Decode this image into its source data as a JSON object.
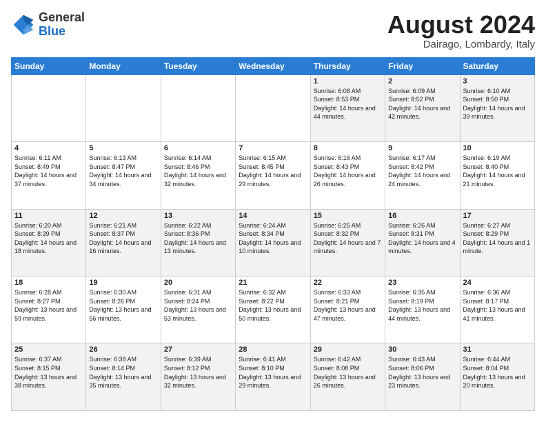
{
  "header": {
    "logo_line1": "General",
    "logo_line2": "Blue",
    "month_year": "August 2024",
    "location": "Dairago, Lombardy, Italy"
  },
  "days_of_week": [
    "Sunday",
    "Monday",
    "Tuesday",
    "Wednesday",
    "Thursday",
    "Friday",
    "Saturday"
  ],
  "weeks": [
    [
      {
        "day": "",
        "info": ""
      },
      {
        "day": "",
        "info": ""
      },
      {
        "day": "",
        "info": ""
      },
      {
        "day": "",
        "info": ""
      },
      {
        "day": "1",
        "info": "Sunrise: 6:08 AM\nSunset: 8:53 PM\nDaylight: 14 hours and 44 minutes."
      },
      {
        "day": "2",
        "info": "Sunrise: 6:09 AM\nSunset: 8:52 PM\nDaylight: 14 hours and 42 minutes."
      },
      {
        "day": "3",
        "info": "Sunrise: 6:10 AM\nSunset: 8:50 PM\nDaylight: 14 hours and 39 minutes."
      }
    ],
    [
      {
        "day": "4",
        "info": "Sunrise: 6:11 AM\nSunset: 8:49 PM\nDaylight: 14 hours and 37 minutes."
      },
      {
        "day": "5",
        "info": "Sunrise: 6:13 AM\nSunset: 8:47 PM\nDaylight: 14 hours and 34 minutes."
      },
      {
        "day": "6",
        "info": "Sunrise: 6:14 AM\nSunset: 8:46 PM\nDaylight: 14 hours and 32 minutes."
      },
      {
        "day": "7",
        "info": "Sunrise: 6:15 AM\nSunset: 8:45 PM\nDaylight: 14 hours and 29 minutes."
      },
      {
        "day": "8",
        "info": "Sunrise: 6:16 AM\nSunset: 8:43 PM\nDaylight: 14 hours and 26 minutes."
      },
      {
        "day": "9",
        "info": "Sunrise: 6:17 AM\nSunset: 8:42 PM\nDaylight: 14 hours and 24 minutes."
      },
      {
        "day": "10",
        "info": "Sunrise: 6:19 AM\nSunset: 8:40 PM\nDaylight: 14 hours and 21 minutes."
      }
    ],
    [
      {
        "day": "11",
        "info": "Sunrise: 6:20 AM\nSunset: 8:39 PM\nDaylight: 14 hours and 18 minutes."
      },
      {
        "day": "12",
        "info": "Sunrise: 6:21 AM\nSunset: 8:37 PM\nDaylight: 14 hours and 16 minutes."
      },
      {
        "day": "13",
        "info": "Sunrise: 6:22 AM\nSunset: 8:36 PM\nDaylight: 14 hours and 13 minutes."
      },
      {
        "day": "14",
        "info": "Sunrise: 6:24 AM\nSunset: 8:34 PM\nDaylight: 14 hours and 10 minutes."
      },
      {
        "day": "15",
        "info": "Sunrise: 6:25 AM\nSunset: 8:32 PM\nDaylight: 14 hours and 7 minutes."
      },
      {
        "day": "16",
        "info": "Sunrise: 6:26 AM\nSunset: 8:31 PM\nDaylight: 14 hours and 4 minutes."
      },
      {
        "day": "17",
        "info": "Sunrise: 6:27 AM\nSunset: 8:29 PM\nDaylight: 14 hours and 1 minute."
      }
    ],
    [
      {
        "day": "18",
        "info": "Sunrise: 6:28 AM\nSunset: 8:27 PM\nDaylight: 13 hours and 59 minutes."
      },
      {
        "day": "19",
        "info": "Sunrise: 6:30 AM\nSunset: 8:26 PM\nDaylight: 13 hours and 56 minutes."
      },
      {
        "day": "20",
        "info": "Sunrise: 6:31 AM\nSunset: 8:24 PM\nDaylight: 13 hours and 53 minutes."
      },
      {
        "day": "21",
        "info": "Sunrise: 6:32 AM\nSunset: 8:22 PM\nDaylight: 13 hours and 50 minutes."
      },
      {
        "day": "22",
        "info": "Sunrise: 6:33 AM\nSunset: 8:21 PM\nDaylight: 13 hours and 47 minutes."
      },
      {
        "day": "23",
        "info": "Sunrise: 6:35 AM\nSunset: 8:19 PM\nDaylight: 13 hours and 44 minutes."
      },
      {
        "day": "24",
        "info": "Sunrise: 6:36 AM\nSunset: 8:17 PM\nDaylight: 13 hours and 41 minutes."
      }
    ],
    [
      {
        "day": "25",
        "info": "Sunrise: 6:37 AM\nSunset: 8:15 PM\nDaylight: 13 hours and 38 minutes."
      },
      {
        "day": "26",
        "info": "Sunrise: 6:38 AM\nSunset: 8:14 PM\nDaylight: 13 hours and 35 minutes."
      },
      {
        "day": "27",
        "info": "Sunrise: 6:39 AM\nSunset: 8:12 PM\nDaylight: 13 hours and 32 minutes."
      },
      {
        "day": "28",
        "info": "Sunrise: 6:41 AM\nSunset: 8:10 PM\nDaylight: 13 hours and 29 minutes."
      },
      {
        "day": "29",
        "info": "Sunrise: 6:42 AM\nSunset: 8:08 PM\nDaylight: 13 hours and 26 minutes."
      },
      {
        "day": "30",
        "info": "Sunrise: 6:43 AM\nSunset: 8:06 PM\nDaylight: 13 hours and 23 minutes."
      },
      {
        "day": "31",
        "info": "Sunrise: 6:44 AM\nSunset: 8:04 PM\nDaylight: 13 hours and 20 minutes."
      }
    ]
  ]
}
